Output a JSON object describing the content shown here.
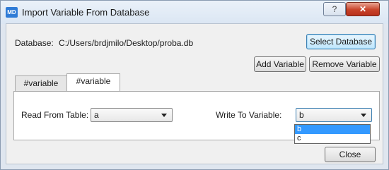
{
  "window": {
    "app_icon_text": "MD",
    "title": "Import Variable From Database",
    "help_glyph": "?",
    "close_glyph": "✕"
  },
  "database": {
    "label": "Database:",
    "path": "C:/Users/brdjmilo/Desktop/proba.db"
  },
  "buttons": {
    "select_database": "Select Database",
    "add_variable": "Add Variable",
    "remove_variable": "Remove Variable",
    "close": "Close"
  },
  "tabs": [
    {
      "label": "#variable",
      "active": false
    },
    {
      "label": "#variable",
      "active": true
    }
  ],
  "form": {
    "read_label": "Read From Table:",
    "read_value": "a",
    "write_label": "Write To Variable:",
    "write_value": "b",
    "write_options": [
      "b",
      "c"
    ],
    "write_selected": "b"
  },
  "colors": {
    "selection": "#3399ff",
    "close_button": "#c8432a"
  }
}
